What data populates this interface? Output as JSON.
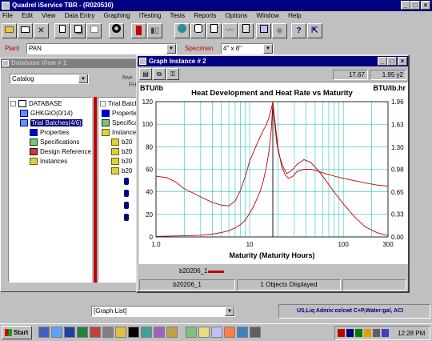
{
  "app": {
    "title": "Quadrel iService  TBR  - (R020530)",
    "menu": [
      "File",
      "Edit",
      "View",
      "Data Entry",
      "Graphing",
      "ITesting",
      "Tests",
      "Reports",
      "Options",
      "Window",
      "Help"
    ]
  },
  "toolbar": {
    "icons": [
      "open-folder-icon",
      "print-icon",
      "delete-icon",
      "copy-icon",
      "paste-icon",
      "properties-icon",
      "refresh-icon",
      "bar-chart-icon",
      "column-chart-icon",
      "globe-icon",
      "database-icon",
      "document-icon",
      "graph-tool-icon",
      "calculator-icon",
      "export-icon",
      "eye-icon",
      "help-icon",
      "pointer-help-icon"
    ]
  },
  "filters": {
    "plant_label": "Plant",
    "plant_value": "PAN",
    "specimen_label": "Specimen",
    "specimen_value": "4\" x 8\""
  },
  "database_view": {
    "title": "Database View # 1",
    "catalog_value": "Catalog",
    "partial_text_1": "ftwe",
    "partial_text_2": "FH",
    "tree": [
      {
        "label": "DATABASE",
        "icon": "database-icon",
        "level": 0
      },
      {
        "label": "GHKGIO(0/14)",
        "icon": "folder-icon",
        "level": 1
      },
      {
        "label": "Trial Batches(4/6)",
        "icon": "folder-icon",
        "level": 1,
        "selected": true
      },
      {
        "label": "Properties",
        "icon": "properties-icon",
        "level": 2
      },
      {
        "label": "Specifications",
        "icon": "specifications-icon",
        "level": 2
      },
      {
        "label": "Design Reference",
        "icon": "design-reference-icon",
        "level": 2
      },
      {
        "label": "Instances",
        "icon": "instances-icon",
        "level": 2
      }
    ],
    "tree2": [
      "Trial Batches",
      "Propertie",
      "Specificat",
      "Instance",
      "b20",
      "b20",
      "b20",
      "b20"
    ]
  },
  "graph_window": {
    "title": "Graph Instance # 2",
    "coord_x": "17.67",
    "coord_y": "1.95 y2",
    "legend_label": "b20206_1",
    "status_item": "b20206_1",
    "status_text": "1 Objects Displayed"
  },
  "chart_data": {
    "type": "line",
    "title": "Heat Development and Heat Rate vs Maturity",
    "xlabel": "Maturity (Maturity Hours)",
    "ylabel_left": "BTU/lb",
    "ylabel_right": "BTU/lb.hr",
    "xscale": "log",
    "xlim": [
      1,
      300
    ],
    "ylim_left": [
      0,
      120
    ],
    "ylim_right": [
      0,
      1.96
    ],
    "x_tick_labels": [
      "1.0",
      "10",
      "100",
      "300"
    ],
    "y_left_tick_labels": [
      "0",
      "20",
      "40",
      "60",
      "80",
      "100",
      "120"
    ],
    "y_right_tick_labels": [
      "0.00",
      "0.33",
      "0.65",
      "0.98",
      "1.30",
      "1.63",
      "1.96"
    ],
    "grid": true,
    "vertical_marker_x": 17.67,
    "series": [
      {
        "axis": "left",
        "color": "#c00000",
        "points": [
          [
            1.0,
            0.5
          ],
          [
            2,
            1
          ],
          [
            3,
            1.5
          ],
          [
            4,
            2.5
          ],
          [
            5,
            4
          ],
          [
            6,
            5.5
          ],
          [
            7,
            8
          ],
          [
            8,
            11
          ],
          [
            9,
            15
          ],
          [
            10,
            21
          ],
          [
            11,
            27
          ],
          [
            12,
            34
          ],
          [
            13,
            41
          ],
          [
            14,
            50
          ],
          [
            15,
            61
          ],
          [
            16,
            75
          ],
          [
            17,
            95
          ],
          [
            17.67,
            119
          ],
          [
            18.5,
            105
          ],
          [
            20,
            80
          ],
          [
            22,
            62
          ],
          [
            24,
            55
          ],
          [
            26,
            52
          ],
          [
            29,
            54
          ],
          [
            32,
            58
          ],
          [
            38,
            60
          ],
          [
            45,
            60
          ],
          [
            55,
            58
          ],
          [
            65,
            56
          ],
          [
            80,
            54
          ],
          [
            100,
            52
          ],
          [
            130,
            50
          ],
          [
            170,
            48
          ],
          [
            230,
            46
          ],
          [
            300,
            45
          ]
        ]
      },
      {
        "axis": "right",
        "color": "#c00000",
        "points": [
          [
            1.0,
            0.88
          ],
          [
            1.3,
            0.86
          ],
          [
            1.6,
            0.8
          ],
          [
            2,
            0.7
          ],
          [
            3,
            0.58
          ],
          [
            4,
            0.5
          ],
          [
            5,
            0.46
          ],
          [
            6,
            0.45
          ],
          [
            7,
            0.52
          ],
          [
            8,
            0.68
          ],
          [
            9,
            0.88
          ],
          [
            10,
            1.1
          ],
          [
            12,
            1.35
          ],
          [
            14,
            1.55
          ],
          [
            15,
            1.62
          ],
          [
            16,
            1.72
          ],
          [
            17,
            1.85
          ],
          [
            17.67,
            1.96
          ],
          [
            18.5,
            1.65
          ],
          [
            19.5,
            1.35
          ],
          [
            21,
            1.15
          ],
          [
            23,
            1.0
          ],
          [
            25,
            0.92
          ],
          [
            28,
            0.96
          ],
          [
            32,
            1.05
          ],
          [
            38,
            1.12
          ],
          [
            45,
            1.08
          ],
          [
            55,
            0.95
          ],
          [
            65,
            0.82
          ],
          [
            80,
            0.65
          ],
          [
            100,
            0.48
          ],
          [
            130,
            0.3
          ],
          [
            170,
            0.15
          ],
          [
            230,
            0.06
          ],
          [
            300,
            0.02
          ]
        ]
      }
    ]
  },
  "bottom": {
    "graph_list_value": "[Graph List]",
    "units_text": "US,Liq Admix:oz/cwt C+P,Water:gal, ACI"
  },
  "taskbar": {
    "start_label": "Start",
    "time": "12:28 PM"
  }
}
